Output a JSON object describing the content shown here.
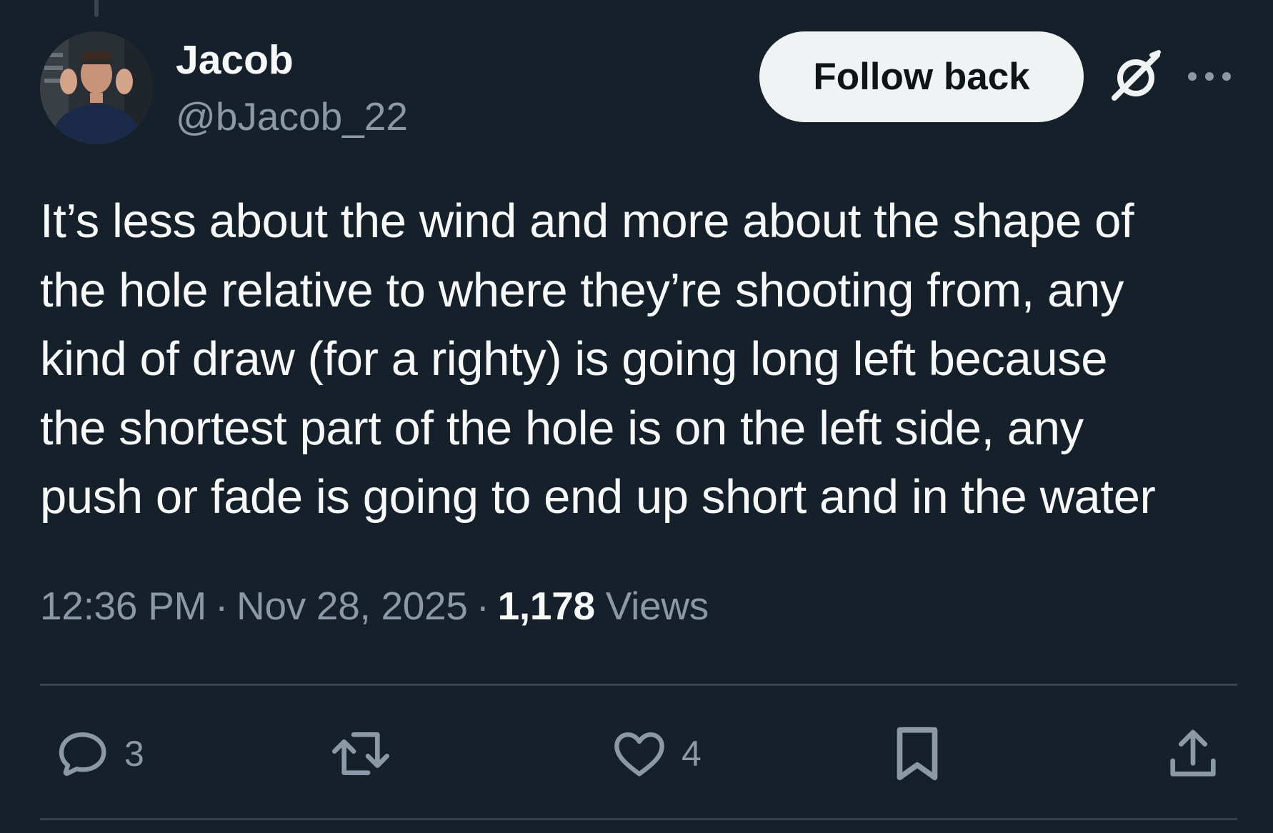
{
  "user": {
    "display_name": "Jacob",
    "handle": "@bJacob_22"
  },
  "header": {
    "follow_label": "Follow back",
    "grok_icon": "grok-icon",
    "more_icon": "more-horizontal-icon"
  },
  "tweet": {
    "text": "It’s less about the wind and more about the shape of\nthe hole relative to where they’re shooting from, any\nkind of draw (for a righty) is going long left because\nthe shortest part of the hole is on the left side, any\npush or fade is going to end up short and in the water",
    "time": "12:36 PM",
    "separator": "·",
    "date": "Nov 28, 2025",
    "views_count": "1,178",
    "views_label": "Views"
  },
  "actions": {
    "replies": "3",
    "likes": "4",
    "icons": [
      "reply-icon",
      "retweet-icon",
      "like-icon",
      "bookmark-icon",
      "share-icon"
    ]
  },
  "colors": {
    "background": "#15202b",
    "text": "#f7f9f9",
    "secondary": "#8b98a5",
    "button_bg": "#eff3f4",
    "divider": "#38444d"
  }
}
